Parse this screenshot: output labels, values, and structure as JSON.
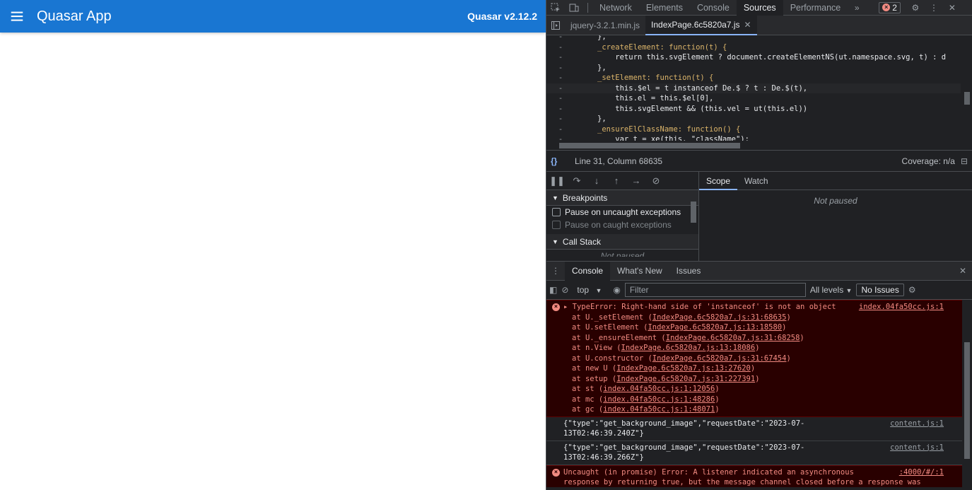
{
  "app": {
    "title": "Quasar App",
    "version": "Quasar v2.12.2",
    "accent": "#1976d2"
  },
  "devtools": {
    "tabs": [
      "Network",
      "Elements",
      "Console",
      "Sources",
      "Performance"
    ],
    "active_tab": "Sources",
    "error_count": "2",
    "file_tabs": [
      "jquery-3.2.1.min.js",
      "IndexPage.6c5820a7.js"
    ],
    "active_file": "IndexPage.6c5820a7.js",
    "code": [
      "},",
      "_createElement: function(t) {",
      "    return this.svgElement ? document.createElementNS(ut.namespace.svg, t) : d",
      "},",
      "_setElement: function(t) {",
      "    this.$el = t instanceof De.$ ? t : De.$(t),",
      "    this.el = this.$el[0],",
      "    this.svgElement && (this.vel = ut(this.el))",
      "},",
      "_ensureElClassName: function() {",
      "    var t = xe(this, \"className\");"
    ],
    "status": {
      "position": "Line 31, Column 68635",
      "coverage": "Coverage: n/a"
    },
    "debugger": {
      "breakpoints_label": "Breakpoints",
      "pause_uncaught": "Pause on uncaught exceptions",
      "pause_caught": "Pause on caught exceptions",
      "call_stack_label": "Call Stack",
      "call_stack_state": "Not paused",
      "scope_tab": "Scope",
      "watch_tab": "Watch",
      "scope_state": "Not paused"
    },
    "drawer_tabs": [
      "Console",
      "What's New",
      "Issues"
    ],
    "console_toolbar": {
      "context": "top",
      "filter_placeholder": "Filter",
      "levels": "All levels",
      "issues": "No Issues"
    },
    "console": {
      "error1": {
        "message": "TypeError: Right-hand side of 'instanceof' is not an object",
        "source": "index.04fa50cc.js:1",
        "frames": [
          {
            "fn": "at U._setElement (",
            "loc": "IndexPage.6c5820a7.js:31:68635",
            "end": ")"
          },
          {
            "fn": "at U.setElement (",
            "loc": "IndexPage.6c5820a7.js:13:18580",
            "end": ")"
          },
          {
            "fn": "at U._ensureElement (",
            "loc": "IndexPage.6c5820a7.js:31:68258",
            "end": ")"
          },
          {
            "fn": "at n.View (",
            "loc": "IndexPage.6c5820a7.js:13:18086",
            "end": ")"
          },
          {
            "fn": "at U.constructor (",
            "loc": "IndexPage.6c5820a7.js:31:67454",
            "end": ")"
          },
          {
            "fn": "at new U (",
            "loc": "IndexPage.6c5820a7.js:13:27620",
            "end": ")"
          },
          {
            "fn": "at setup (",
            "loc": "IndexPage.6c5820a7.js:31:227391",
            "end": ")"
          },
          {
            "fn": "at st (",
            "loc": "index.04fa50cc.js:1:12056",
            "end": ")"
          },
          {
            "fn": "at mc (",
            "loc": "index.04fa50cc.js:1:48286",
            "end": ")"
          },
          {
            "fn": "at gc (",
            "loc": "index.04fa50cc.js:1:48071",
            "end": ")"
          }
        ]
      },
      "log1": {
        "line1": "{\"type\":\"get_background_image\",\"requestDate\":\"2023-07-",
        "line2": "13T02:46:39.240Z\"}",
        "source": "content.js:1"
      },
      "log2": {
        "line1": "{\"type\":\"get_background_image\",\"requestDate\":\"2023-07-",
        "line2": "13T02:46:39.266Z\"}",
        "source": "content.js:1"
      },
      "error2": {
        "line1": "Uncaught (in promise) Error: A listener indicated an asynchronous",
        "line2": "response by returning true, but the message channel closed before a response was",
        "source": ":4000/#/:1"
      }
    }
  }
}
